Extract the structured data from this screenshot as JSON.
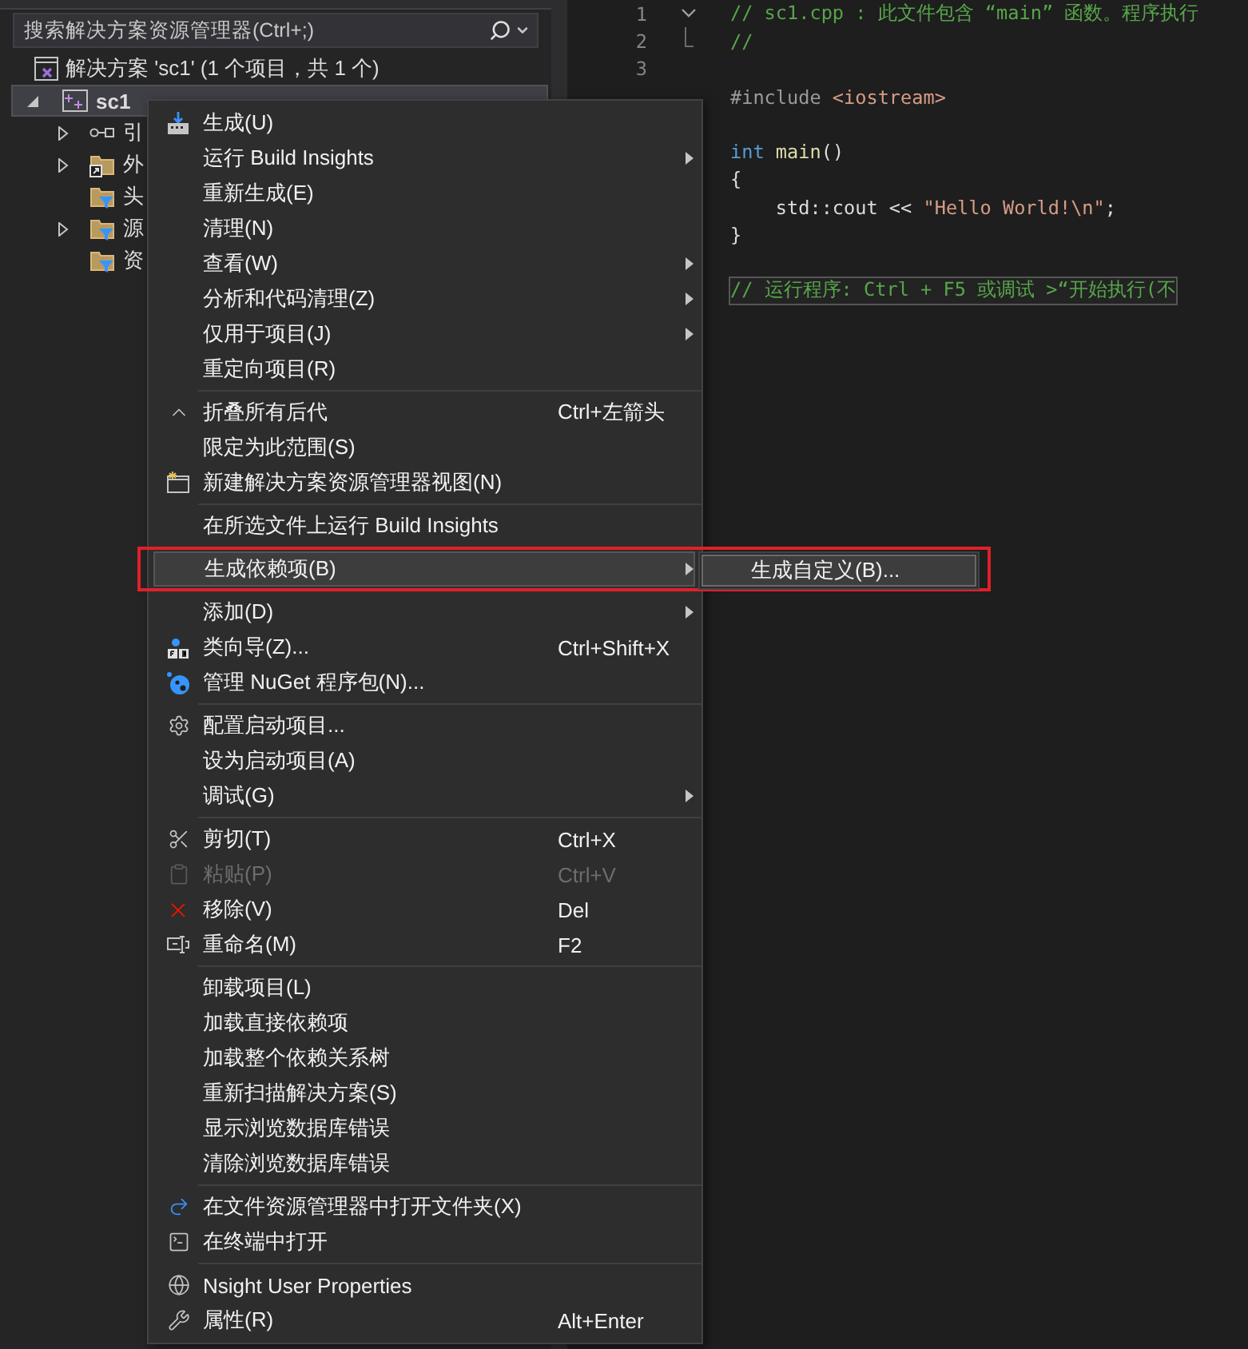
{
  "search": {
    "placeholder": "搜索解决方案资源管理器(Ctrl+;)"
  },
  "solution": {
    "label": "解决方案 'sc1' (1 个项目，共 1 个)"
  },
  "project": {
    "label": "sc1",
    "expanded": true,
    "selected": true,
    "children": [
      {
        "label": "引",
        "expanded": false
      },
      {
        "label": "外",
        "expanded": false
      },
      {
        "label": "头"
      },
      {
        "label": "源",
        "expanded": false
      },
      {
        "label": "资"
      }
    ]
  },
  "code": [
    {
      "number": "1",
      "tokens": [
        {
          "kind": "comment",
          "text": "// sc1.cpp : 此文件包含 “main” 函数。程序执行"
        }
      ]
    },
    {
      "number": "2",
      "tokens": [
        {
          "kind": "comment",
          "text": "//"
        }
      ]
    },
    {
      "number": "3"
    },
    {
      "tokens": [
        {
          "kind": "preproc",
          "text": "#include "
        },
        {
          "kind": "string",
          "text": "<iostream>"
        }
      ]
    },
    {
      "spaced": true,
      "tokens": [
        {
          "kind": "keyword",
          "text": "int "
        },
        {
          "kind": "function",
          "text": "main"
        },
        {
          "kind": "plain",
          "text": "()"
        }
      ]
    },
    {
      "tokens": [
        {
          "kind": "plain",
          "text": "{"
        }
      ]
    },
    {
      "tokens": [
        {
          "kind": "plain",
          "text": "    std::cout << "
        },
        {
          "kind": "string",
          "text": "\"Hello World!\\n\""
        },
        {
          "kind": "plain",
          "text": ";"
        }
      ]
    },
    {
      "tokens": [
        {
          "kind": "plain",
          "text": "}"
        }
      ]
    },
    {
      "spaced": true,
      "boxed": true,
      "tokens": [
        {
          "kind": "comment",
          "text": "// 运行程序: Ctrl + F5 或调试 >“开始执行(不"
        }
      ]
    }
  ],
  "menu": {
    "groups": [
      [
        {
          "label": "生成(U)",
          "submenu": false,
          "disabled": false,
          "selected": false
        },
        {
          "label": "运行 Build Insights",
          "submenu": true,
          "disabled": false,
          "selected": false
        },
        {
          "label": "重新生成(E)",
          "submenu": false,
          "disabled": false,
          "selected": false
        },
        {
          "label": "清理(N)",
          "submenu": false,
          "disabled": false,
          "selected": false
        },
        {
          "label": "查看(W)",
          "submenu": true,
          "disabled": false,
          "selected": false
        },
        {
          "label": "分析和代码清理(Z)",
          "submenu": true,
          "disabled": false,
          "selected": false
        },
        {
          "label": "仅用于项目(J)",
          "submenu": true,
          "disabled": false,
          "selected": false
        },
        {
          "label": "重定向项目(R)",
          "submenu": false,
          "disabled": false,
          "selected": false
        }
      ],
      [
        {
          "label": "折叠所有后代",
          "shortcut": "Ctrl+左箭头",
          "submenu": false,
          "disabled": false,
          "selected": false
        },
        {
          "label": "限定为此范围(S)",
          "submenu": false,
          "disabled": false,
          "selected": false
        },
        {
          "label": "新建解决方案资源管理器视图(N)",
          "submenu": false,
          "disabled": false,
          "selected": false
        }
      ],
      [
        {
          "label": "在所选文件上运行 Build Insights",
          "submenu": false,
          "disabled": false,
          "selected": false
        }
      ],
      [
        {
          "label": "生成依赖项(B)",
          "submenu": true,
          "disabled": false,
          "selected": true,
          "annotated": true,
          "submenu_items": [
            {
              "label": "生成自定义(B)...",
              "selected": true
            }
          ]
        }
      ],
      [
        {
          "label": "添加(D)",
          "submenu": true,
          "disabled": false,
          "selected": false
        },
        {
          "label": "类向导(Z)...",
          "shortcut": "Ctrl+Shift+X",
          "submenu": false,
          "disabled": false,
          "selected": false
        },
        {
          "label": "管理 NuGet 程序包(N)...",
          "submenu": false,
          "disabled": false,
          "selected": false
        }
      ],
      [
        {
          "label": "配置启动项目...",
          "submenu": false,
          "disabled": false,
          "selected": false
        },
        {
          "label": "设为启动项目(A)",
          "submenu": false,
          "disabled": false,
          "selected": false
        },
        {
          "label": "调试(G)",
          "submenu": true,
          "disabled": false,
          "selected": false
        }
      ],
      [
        {
          "label": "剪切(T)",
          "shortcut": "Ctrl+X",
          "submenu": false,
          "disabled": false,
          "selected": false
        },
        {
          "label": "粘贴(P)",
          "shortcut": "Ctrl+V",
          "submenu": false,
          "disabled": true,
          "selected": false
        },
        {
          "label": "移除(V)",
          "shortcut": "Del",
          "submenu": false,
          "disabled": false,
          "selected": false
        },
        {
          "label": "重命名(M)",
          "shortcut": "F2",
          "submenu": false,
          "disabled": false,
          "selected": false
        }
      ],
      [
        {
          "label": "卸载项目(L)",
          "submenu": false,
          "disabled": false,
          "selected": false
        },
        {
          "label": "加载直接依赖项",
          "submenu": false,
          "disabled": false,
          "selected": false
        },
        {
          "label": "加载整个依赖关系树",
          "submenu": false,
          "disabled": false,
          "selected": false
        },
        {
          "label": "重新扫描解决方案(S)",
          "submenu": false,
          "disabled": false,
          "selected": false
        },
        {
          "label": "显示浏览数据库错误",
          "submenu": false,
          "disabled": false,
          "selected": false
        },
        {
          "label": "清除浏览数据库错误",
          "submenu": false,
          "disabled": false,
          "selected": false
        }
      ],
      [
        {
          "label": "在文件资源管理器中打开文件夹(X)",
          "submenu": false,
          "disabled": false,
          "selected": false
        },
        {
          "label": "在终端中打开",
          "submenu": false,
          "disabled": false,
          "selected": false
        }
      ],
      [
        {
          "label": "Nsight User Properties",
          "submenu": false,
          "disabled": false,
          "selected": false
        },
        {
          "label": "属性(R)",
          "shortcut": "Alt+Enter",
          "submenu": false,
          "disabled": false,
          "selected": false
        }
      ]
    ]
  }
}
